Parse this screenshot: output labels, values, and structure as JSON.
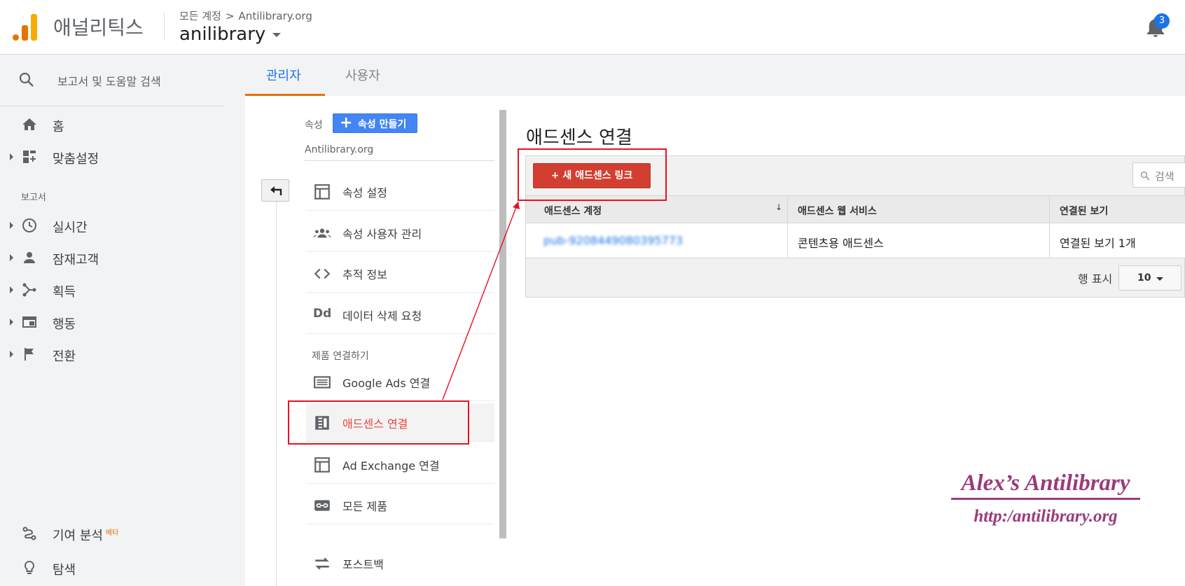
{
  "header": {
    "app_title": "애널리틱스",
    "breadcrumb_root": "모든 계정",
    "breadcrumb_arrow": ">",
    "breadcrumb_account": "Antilibrary.org",
    "account_name": "anilibrary",
    "notification_count": "3"
  },
  "sidebar": {
    "search_label": "보고서 및 도움말 검색",
    "home": "홈",
    "customization": "맞춤설정",
    "reports_section": "보고서",
    "realtime": "실시간",
    "audience": "잠재고객",
    "acquisition": "획득",
    "behavior": "행동",
    "conversions": "전환",
    "attribution": "기여 분석",
    "beta": "베타",
    "discover": "탐색"
  },
  "tabs": {
    "admin": "관리자",
    "user": "사용자"
  },
  "admin": {
    "property_label": "속성",
    "create_property": "속성 만들기",
    "create_plus": "+",
    "property_name": "Antilibrary.org",
    "menu": {
      "property_settings": "속성 설정",
      "property_user_mgmt": "속성 사용자 관리",
      "tracking_info": "추적 정보",
      "data_deletion": "데이터 삭제 요청",
      "product_linking": "제품 연결하기",
      "google_ads": "Google Ads 연결",
      "adsense": "애드센스 연결",
      "ad_exchange": "Ad Exchange 연결",
      "all_products": "모든 제품",
      "postbacks": "포스트백"
    },
    "data_deletion_icon_text": "Dd"
  },
  "main": {
    "title": "애드센스 연결",
    "new_link_button": "+ 새 애드센스 링크",
    "search_placeholder": "검색",
    "columns": [
      "애드센스 계정",
      "애드센스 웹 서비스",
      "연결된 보기"
    ],
    "sort_indicator": "↓",
    "rows": [
      {
        "account": "pub-9208449080395773",
        "service": "콘텐츠용 애드센스",
        "views": "연결된 보기 1개"
      }
    ],
    "rows_label": "행 표시",
    "rows_value": "10"
  },
  "watermark": {
    "line1": "Alex’s Antilibrary",
    "line2": "http:/antilibrary.org"
  },
  "colors": {
    "accent_blue": "#1a73e8",
    "accent_orange": "#e8710a",
    "button_red": "#d23f31",
    "highlight_red": "#e81123",
    "watermark_purple": "#9b3b7d"
  }
}
